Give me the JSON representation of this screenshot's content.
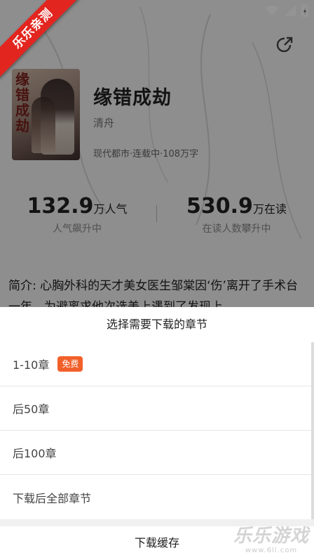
{
  "ribbon_text": "乐乐亲测",
  "book": {
    "title": "缘错成劫",
    "author": "清舟",
    "meta": "现代都市·连载中·108万字",
    "cover_title": "缘错成劫"
  },
  "stats": {
    "popularity": {
      "number": "132.9",
      "unit": "万人气",
      "sub": "人气飙升中"
    },
    "reading": {
      "number": "530.9",
      "unit": "万在读",
      "sub": "在读人数攀升中"
    }
  },
  "intro_text": "简介: 心胸外科的天才美女医生邹棠因‘伤’离开了手术台一年，为避离求他次选美上遇到了发现上",
  "download_sheet": {
    "title": "选择需要下载的章节",
    "options": [
      {
        "label": "1-10章",
        "badge": "免费"
      },
      {
        "label": "后50章"
      },
      {
        "label": "后100章"
      },
      {
        "label": "下载后全部章节"
      }
    ],
    "download_button": "下载缓存"
  },
  "watermark": {
    "main": "乐乐游戏",
    "sub": "www.6ll.com"
  },
  "colors": {
    "badge": "#f2602a",
    "ribbon": "#e2261f",
    "overlay": "rgba(0,0,0,0.42)"
  }
}
